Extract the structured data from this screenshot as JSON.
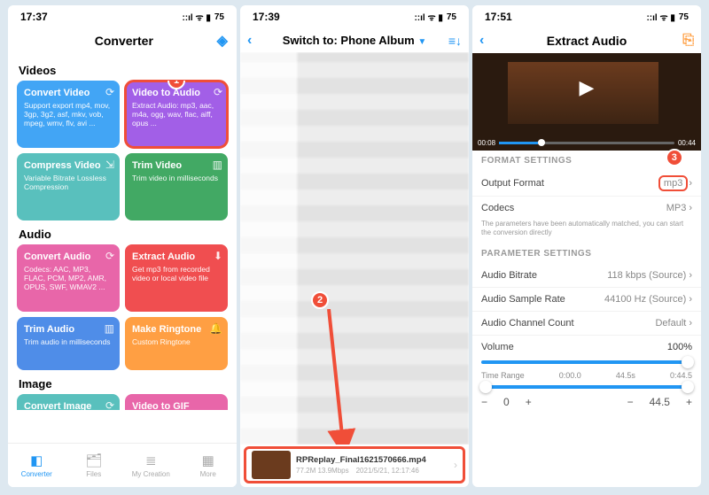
{
  "screen1": {
    "time": "17:37",
    "header_title": "Converter",
    "sections": {
      "videos": "Videos",
      "audio": "Audio",
      "image": "Image"
    },
    "cards": {
      "convert_video": {
        "t": "Convert Video",
        "d": "Support export mp4, mov, 3gp, 3g2, asf, mkv, vob, mpeg, wmv, flv, avi ..."
      },
      "video_to_audio": {
        "t": "Video to Audio",
        "d": "Extract Audio: mp3, aac, m4a, ogg, wav, flac, aiff, opus ..."
      },
      "compress_video": {
        "t": "Compress Video",
        "d": "Variable Bitrate Lossless Compression"
      },
      "trim_video": {
        "t": "Trim Video",
        "d": "Trim video in milliseconds"
      },
      "convert_audio": {
        "t": "Convert Audio",
        "d": "Codecs: AAC, MP3, FLAC, PCM, MP2, AMR, OPUS, SWF, WMAV2 ..."
      },
      "extract_audio": {
        "t": "Extract Audio",
        "d": "Get mp3 from recorded video or local video file"
      },
      "trim_audio": {
        "t": "Trim Audio",
        "d": "Trim audio in milliseconds"
      },
      "make_ringtone": {
        "t": "Make Ringtone",
        "d": "Custom Ringtone"
      },
      "convert_image": {
        "t": "Convert Image",
        "d": ""
      },
      "video_to_gif": {
        "t": "Video to GIF",
        "d": ""
      }
    },
    "tabs": {
      "converter": "Converter",
      "files": "Files",
      "creation": "My Creation",
      "more": "More"
    },
    "marker": "1"
  },
  "screen2": {
    "time": "17:39",
    "title": "Switch to: Phone Album",
    "marker": "2",
    "file": {
      "name": "RPReplay_Final1621570666.mp4",
      "size": "77.2M 13.9Mbps",
      "date": "2021/5/21, 12:17:46"
    }
  },
  "screen3": {
    "time": "17:51",
    "title": "Extract Audio",
    "marker": "3",
    "format_header": "FORMAT SETTINGS",
    "param_header": "PARAMETER SETTINGS",
    "output_format_label": "Output Format",
    "output_format_value": "mp3",
    "codecs_label": "Codecs",
    "codecs_value": "MP3",
    "hint": "The parameters have been automatically matched, you can start the conversion directly",
    "bitrate_label": "Audio Bitrate",
    "bitrate_value": "118 kbps (Source)",
    "samplerate_label": "Audio Sample Rate",
    "samplerate_value": "44100 Hz (Source)",
    "channel_label": "Audio Channel Count",
    "channel_value": "Default",
    "volume_label": "Volume",
    "volume_value": "100%",
    "timerange_label": "Time Range",
    "t_start": "0:00.0",
    "t_mid": "44.5s",
    "t_end": "0:44.5",
    "pm": {
      "minus": "−",
      "plus": "+",
      "left_val": "0",
      "right_val": "44.5"
    },
    "player": {
      "cur": "00:08",
      "total": "00:44"
    }
  },
  "battery": "75"
}
